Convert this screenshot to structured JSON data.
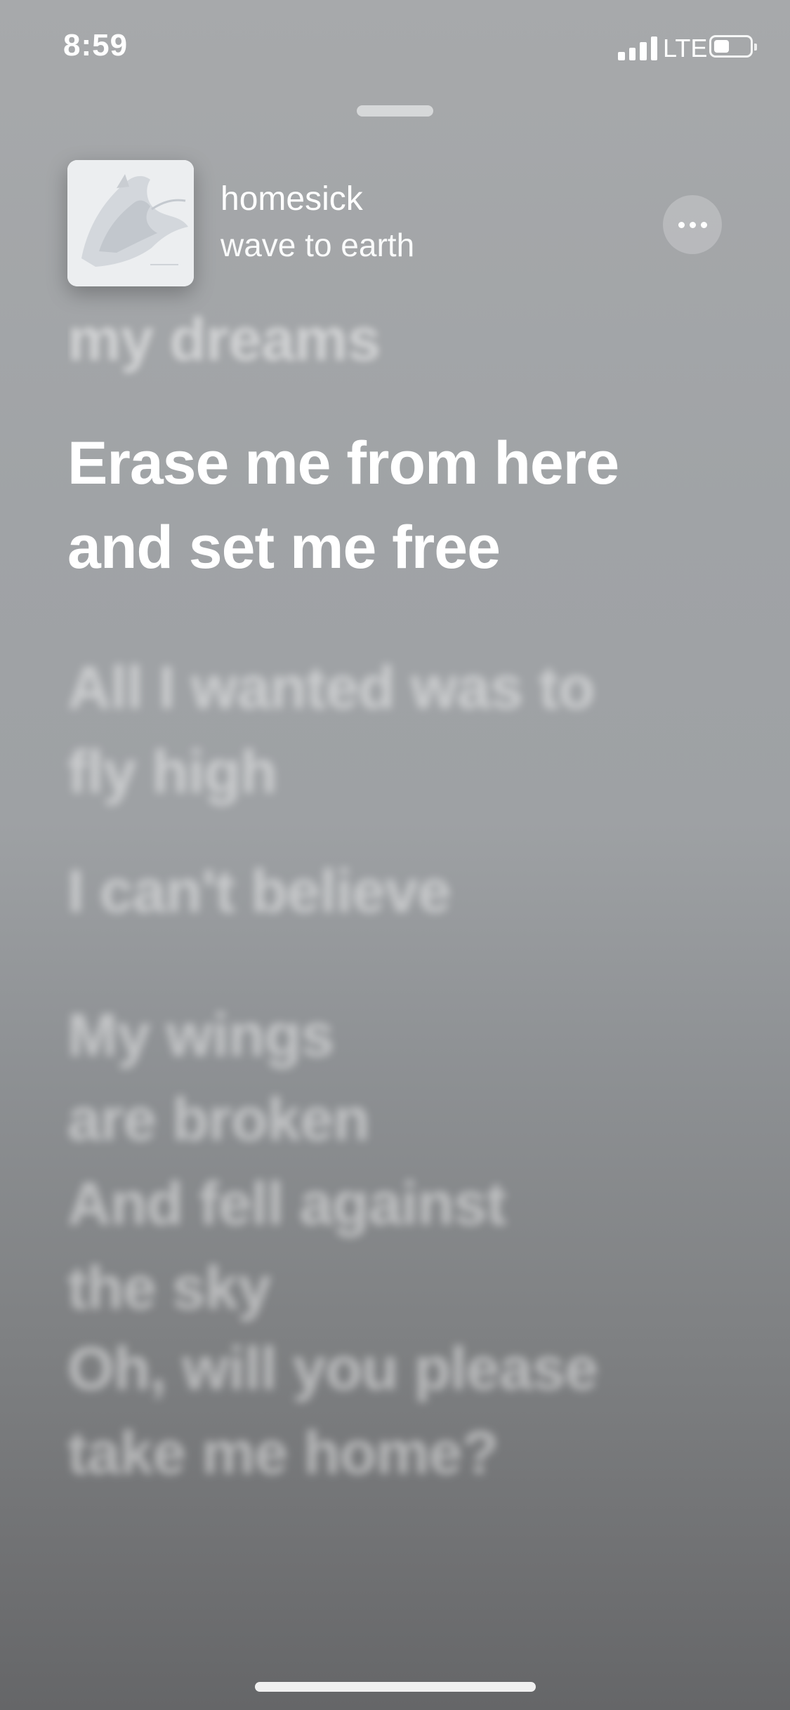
{
  "status_bar": {
    "time": "8:59",
    "network": "LTE",
    "icons": [
      "signal-icon",
      "battery-icon"
    ]
  },
  "now_playing": {
    "title": "homesick",
    "artist": "wave to earth",
    "more_icon": "ellipsis-icon"
  },
  "lyrics": {
    "previous": "my dreams",
    "current": "Erase me from here\nand set me free",
    "upcoming": [
      "All I wanted was to\nfly high",
      "I can't believe",
      "My wings\nare broken",
      "And fell against\nthe sky",
      "Oh, will you please\ntake me home?"
    ]
  },
  "colors": {
    "background_top": "#a7a9ab",
    "background_bottom": "#656668",
    "text": "#ffffff"
  }
}
